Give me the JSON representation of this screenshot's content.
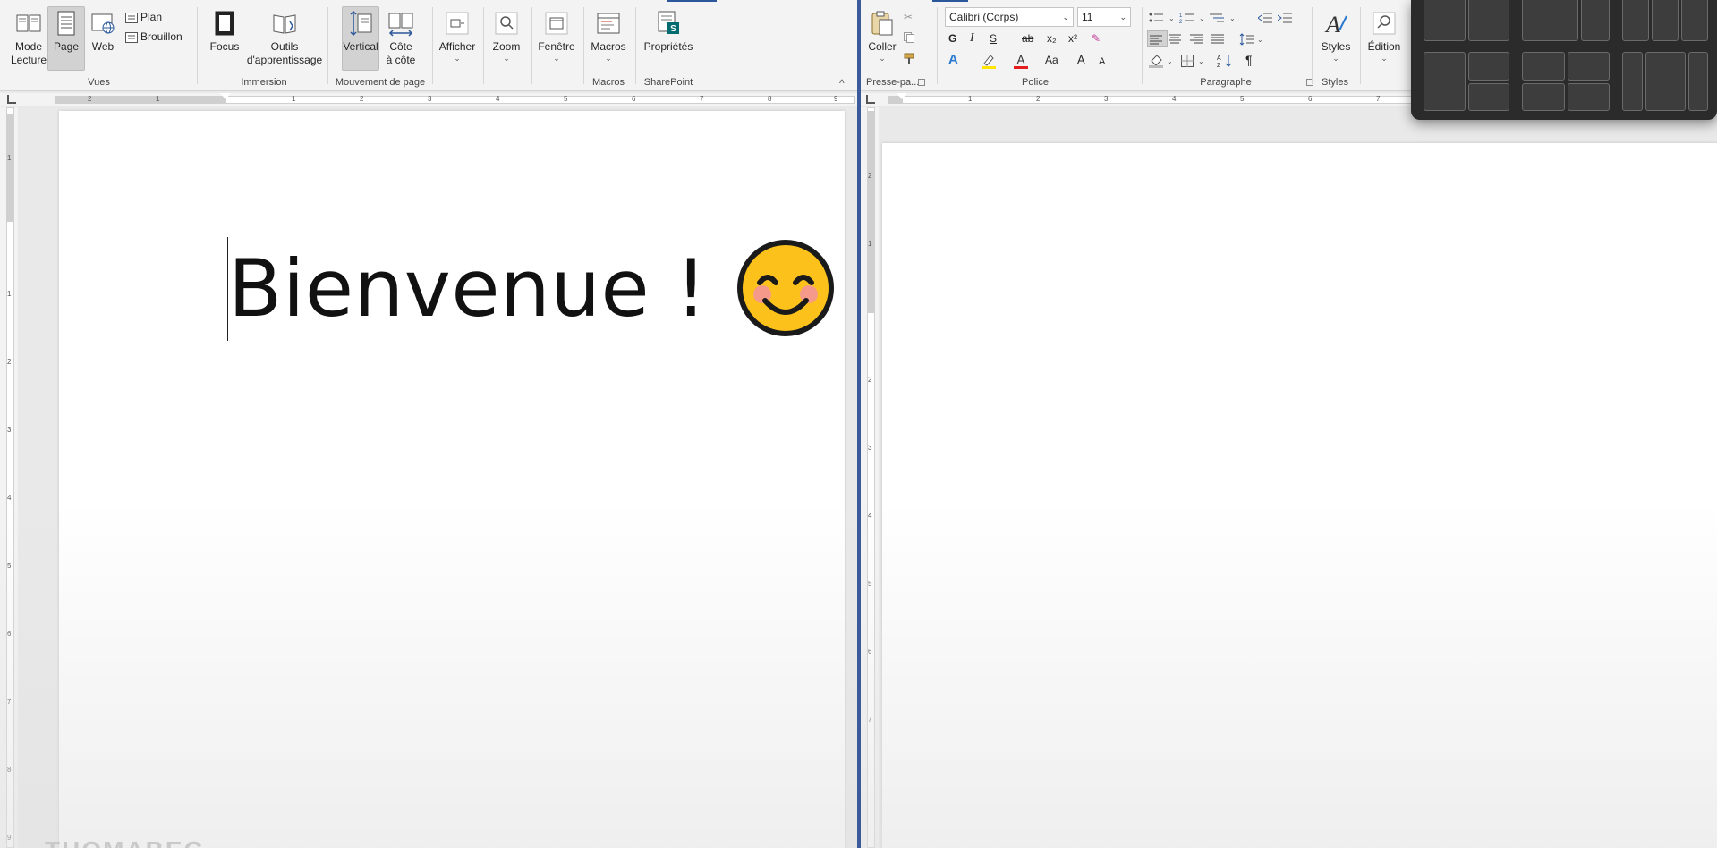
{
  "left_window": {
    "ribbon": {
      "views_group": {
        "label": "Vues",
        "mode_lecture": "Mode\nLecture",
        "mode_lecture_l1": "Mode",
        "mode_lecture_l2": "Lecture",
        "page": "Page",
        "web": "Web",
        "plan": "Plan",
        "brouillon": "Brouillon"
      },
      "immersion_group": {
        "label": "Immersion",
        "focus": "Focus",
        "outils_l1": "Outils",
        "outils_l2": "d'apprentissage"
      },
      "movement_group": {
        "label": "Mouvement de page",
        "vertical": "Vertical",
        "cote_l1": "Côte",
        "cote_l2": "à côte"
      },
      "show_group": {
        "afficher": "Afficher",
        "zoom": "Zoom",
        "fenetre": "Fenêtre"
      },
      "macros_group": {
        "label": "Macros",
        "macros": "Macros"
      },
      "sharepoint_group": {
        "label": "SharePoint",
        "proprietes": "Propriétés"
      }
    },
    "ruler_numbers": [
      "2",
      "1",
      "1",
      "1",
      "2",
      "3",
      "4",
      "5",
      "6",
      "7",
      "8",
      "9"
    ],
    "vruler_numbers": [
      "1",
      "1",
      "1",
      "2",
      "3",
      "4",
      "5",
      "6",
      "7",
      "8",
      "9"
    ],
    "document": {
      "text": "Bienvenue !",
      "emoji": "smiling-face-with-smiling-eyes"
    }
  },
  "right_window": {
    "ribbon": {
      "clipboard_group": {
        "label": "Presse-pa...",
        "coller": "Coller"
      },
      "font_group": {
        "label": "Police",
        "font_name": "Calibri (Corps)",
        "font_size": "11",
        "bold": "G",
        "italic": "I",
        "underline": "S",
        "strike": "ab",
        "subscript": "x₂",
        "superscript": "x²",
        "change_case": "Aa",
        "grow": "A",
        "shrink": "A"
      },
      "paragraph_group": {
        "label": "Paragraphe",
        "pilcrow": "¶"
      },
      "styles_group": {
        "label": "Styles",
        "styles": "Styles"
      },
      "editing_group": {
        "edition": "Édition"
      }
    },
    "ruler_numbers": [
      "1",
      "1",
      "2",
      "3",
      "4",
      "5",
      "6",
      "7"
    ],
    "vruler_numbers": [
      "2",
      "1",
      "1",
      "2",
      "3",
      "4",
      "5",
      "6",
      "7"
    ]
  },
  "watermark": "THOMABEG",
  "colors": {
    "accent": "#2b579a",
    "ribbon_bg": "#f3f3f3",
    "canvas_bg": "#e9e9e9",
    "flyout_bg": "#2b2b2b"
  }
}
